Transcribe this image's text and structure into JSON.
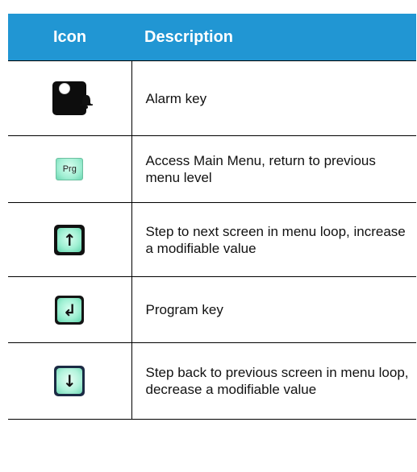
{
  "table": {
    "header": {
      "icon": "Icon",
      "description": "Description"
    },
    "rows": [
      {
        "icon": "alarm-bell-icon",
        "description": "Alarm key"
      },
      {
        "icon": "prg-key-icon",
        "icon_label": "Prg",
        "description": "Access Main Menu, return to previous menu level"
      },
      {
        "icon": "up-arrow-icon",
        "description": "Step to next screen in menu loop, increase a modifiable value"
      },
      {
        "icon": "enter-return-icon",
        "description": "Program key"
      },
      {
        "icon": "down-arrow-icon",
        "description": "Step back to previous screen in menu loop, decrease a modifiable value"
      }
    ]
  },
  "colors": {
    "header_background": "#2196d3",
    "header_text": "#ffffff",
    "key_face": "#9ff0d3",
    "key_border": "#111111"
  }
}
